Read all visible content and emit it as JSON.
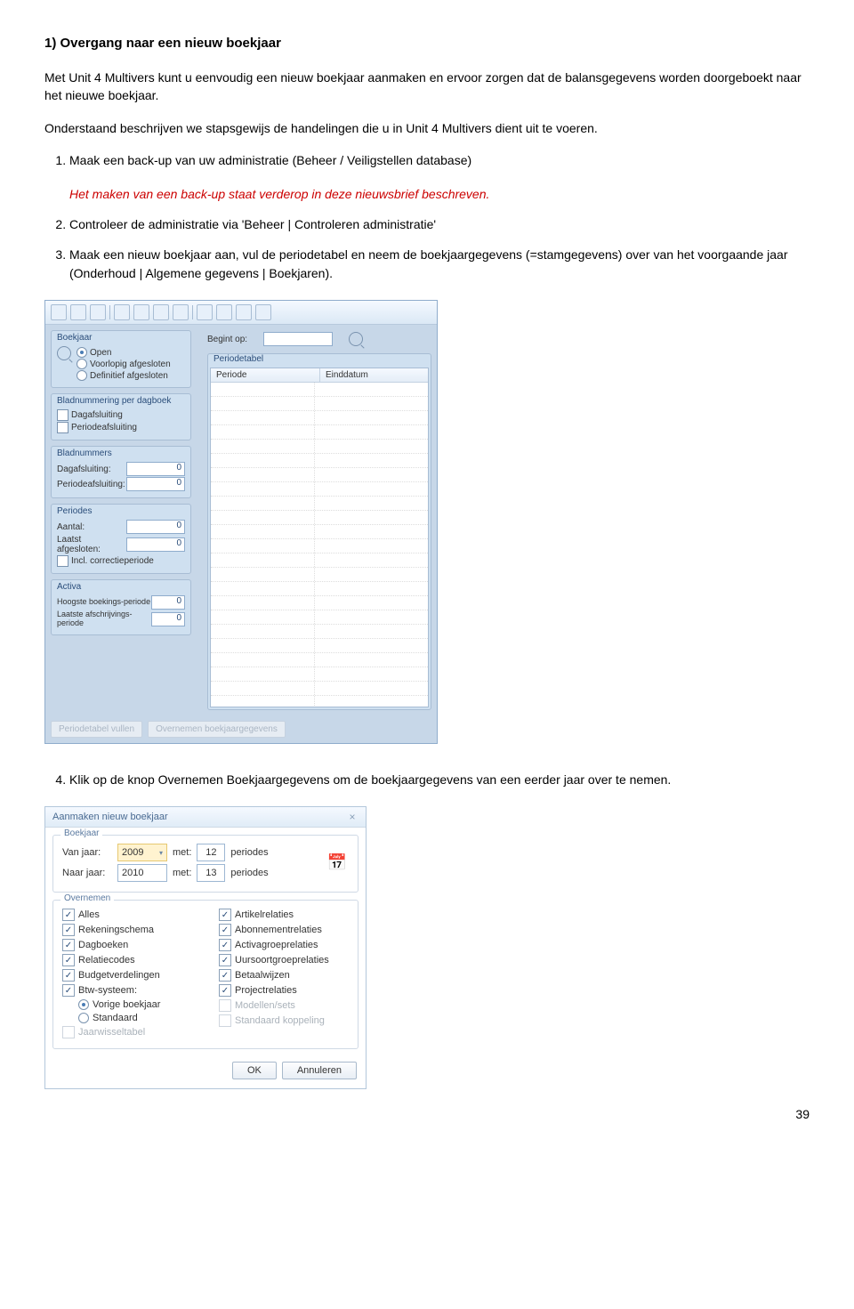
{
  "heading": "1) Overgang naar een nieuw boekjaar",
  "intro1": "Met Unit 4 Multivers kunt u eenvoudig een nieuw boekjaar aanmaken en ervoor zorgen dat de balansgegevens worden doorgeboekt naar het nieuwe boekjaar.",
  "intro2": "Onderstaand beschrijven we stapsgewijs de handelingen die u in Unit 4 Multivers dient uit te voeren.",
  "step1": "Maak een back-up van uw administratie (Beheer / Veiligstellen database)",
  "step1_note": "Het maken van een back-up staat verderop in deze nieuwsbrief beschreven.",
  "step2": "Controleer de administratie via 'Beheer | Controleren administratie'",
  "step3": "Maak een nieuw boekjaar aan, vul de periodetabel en neem de boekjaargegevens (=stamgegevens) over van het voorgaande jaar  (Onderhoud | Algemene gegevens | Boekjaren).",
  "screenshot1": {
    "boekjaar_label": "Boekjaar",
    "status_open": "Open",
    "status_voorlopig": "Voorlopig afgesloten",
    "status_definitief": "Definitief afgesloten",
    "begint_op": "Begint op:",
    "bladnummering_label": "Bladnummering per dagboek",
    "dagafsluiting": "Dagafsluiting",
    "periodeafsluiting": "Periodeafsluiting",
    "bladnummers_label": "Bladnummers",
    "dagafsluiting2": "Dagafsluiting:",
    "periodeafsluiting2": "Periodeafsluiting:",
    "periodes_label": "Periodes",
    "aantal": "Aantal:",
    "laatst_afgesloten": "Laatst afgesloten:",
    "incl_corr": "Incl. correctieperiode",
    "activa_label": "Activa",
    "hoogste_boek": "Hoogste boekings-periode",
    "laatste_afsch": "Laatste afschrijvings-periode",
    "zero": "0",
    "periodetabel_label": "Periodetabel",
    "col_periode": "Periode",
    "col_einddatum": "Einddatum",
    "btn_vullen": "Periodetabel vullen",
    "btn_overnemen": "Overnemen boekjaargegevens"
  },
  "step4": "Klik op de knop Overnemen Boekjaargegevens om de boekjaargegevens van een eerder jaar over te nemen.",
  "dialog2": {
    "title": "Aanmaken nieuw boekjaar",
    "boekjaar_legend": "Boekjaar",
    "van_jaar": "Van jaar:",
    "naar_jaar": "Naar jaar:",
    "met": "met:",
    "periodes": "periodes",
    "year_from": "2009",
    "year_to": "2010",
    "p_from": "12",
    "p_to": "13",
    "overnemen_legend": "Overnemen",
    "left": [
      {
        "label": "Alles",
        "checked": true
      },
      {
        "label": "Rekeningschema",
        "checked": true
      },
      {
        "label": "Dagboeken",
        "checked": true
      },
      {
        "label": "Relatiecodes",
        "checked": true
      },
      {
        "label": "Budgetverdelingen",
        "checked": true
      },
      {
        "label": "Btw-systeem:",
        "checked": true
      }
    ],
    "radios": {
      "vorige": "Vorige boekjaar",
      "standaard": "Standaard"
    },
    "jaarwissel": "Jaarwisseltabel",
    "right": [
      {
        "label": "Artikelrelaties",
        "checked": true
      },
      {
        "label": "Abonnementrelaties",
        "checked": true
      },
      {
        "label": "Activagroeprelaties",
        "checked": true
      },
      {
        "label": "Uursoortgroeprelaties",
        "checked": true
      },
      {
        "label": "Betaalwijzen",
        "checked": true
      },
      {
        "label": "Projectrelaties",
        "checked": true
      },
      {
        "label": "Modellen/sets",
        "checked": false,
        "disabled": true
      },
      {
        "label": "Standaard koppeling",
        "checked": false,
        "disabled": true
      }
    ],
    "ok": "OK",
    "cancel": "Annuleren"
  },
  "page_number": "39"
}
